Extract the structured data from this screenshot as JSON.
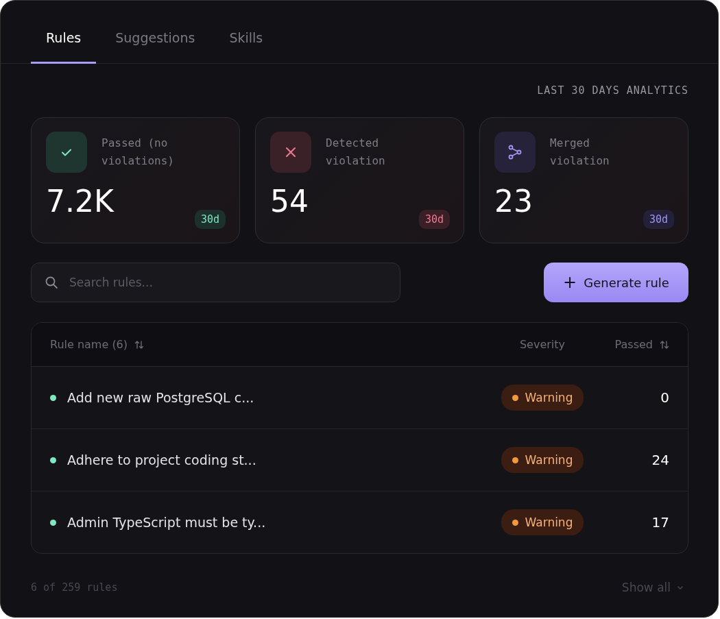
{
  "tabs": [
    {
      "label": "Rules",
      "selected": true
    },
    {
      "label": "Suggestions",
      "selected": false
    },
    {
      "label": "Skills",
      "selected": false
    }
  ],
  "analytics_label": "LAST 30 DAYS ANALYTICS",
  "stats": [
    {
      "kind": "passed",
      "label": "Passed (no violations)",
      "value": "7.2K",
      "period": "30d"
    },
    {
      "kind": "detected",
      "label": "Detected violation",
      "value": "54",
      "period": "30d"
    },
    {
      "kind": "merged",
      "label": "Merged violation",
      "value": "23",
      "period": "30d"
    }
  ],
  "search": {
    "placeholder": "Search rules..."
  },
  "generate_button": {
    "icon": "+",
    "label": "Generate rule"
  },
  "table": {
    "columns": [
      {
        "label": "Rule name (6)",
        "sortable": true
      },
      {
        "label": "Severity",
        "sortable": false
      },
      {
        "label": "Passed",
        "sortable": true
      }
    ],
    "rows": [
      {
        "name": "Add new raw PostgreSQL c...",
        "severity": {
          "kind": "warning",
          "label": "Warning"
        },
        "passed": "0"
      },
      {
        "name": "Adhere to project coding st...",
        "severity": {
          "kind": "warning",
          "label": "Warning"
        },
        "passed": "24"
      },
      {
        "name": "Admin TypeScript must be ty...",
        "severity": {
          "kind": "warning",
          "label": "Warning"
        },
        "passed": "17"
      }
    ]
  },
  "footer": {
    "count": "6 of 259 rules",
    "show_all": "Show all"
  }
}
